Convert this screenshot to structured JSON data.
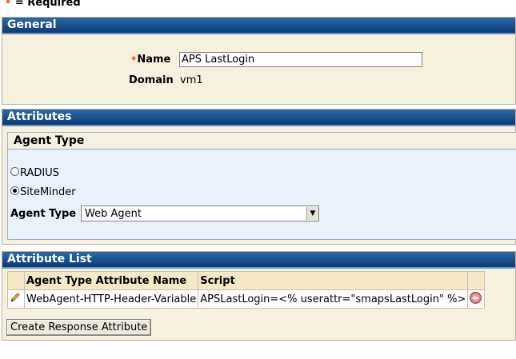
{
  "required_note": {
    "marker": "•",
    "text": "= Required"
  },
  "general": {
    "title": "General",
    "name_label": "Name",
    "name_value": "APS LastLogin",
    "domain_label": "Domain",
    "domain_value": "vm1"
  },
  "attributes": {
    "title": "Attributes",
    "agent_type_panel": {
      "title": "Agent Type",
      "radio_options": [
        {
          "label": "RADIUS",
          "checked": false
        },
        {
          "label": "SiteMinder",
          "checked": true
        }
      ],
      "agent_type_label": "Agent Type",
      "agent_type_selected": "Web Agent"
    }
  },
  "attribute_list": {
    "title": "Attribute List",
    "columns": [
      "Agent Type Attribute Name",
      "Script"
    ],
    "rows": [
      {
        "name": "WebAgent-HTTP-Header-Variable",
        "script": "APSLastLogin=<% userattr=\"smapsLastLogin\" %>"
      }
    ],
    "create_button": "Create Response Attribute"
  },
  "icons": {
    "edit": "pencil-icon",
    "remove": "remove-icon",
    "dropdown": "chevron-down-icon"
  },
  "colors": {
    "header": "#0a3b78",
    "panel_bg": "#f6f0de",
    "required": "#e9762b",
    "subpanel_bg": "#eaf1fb"
  }
}
